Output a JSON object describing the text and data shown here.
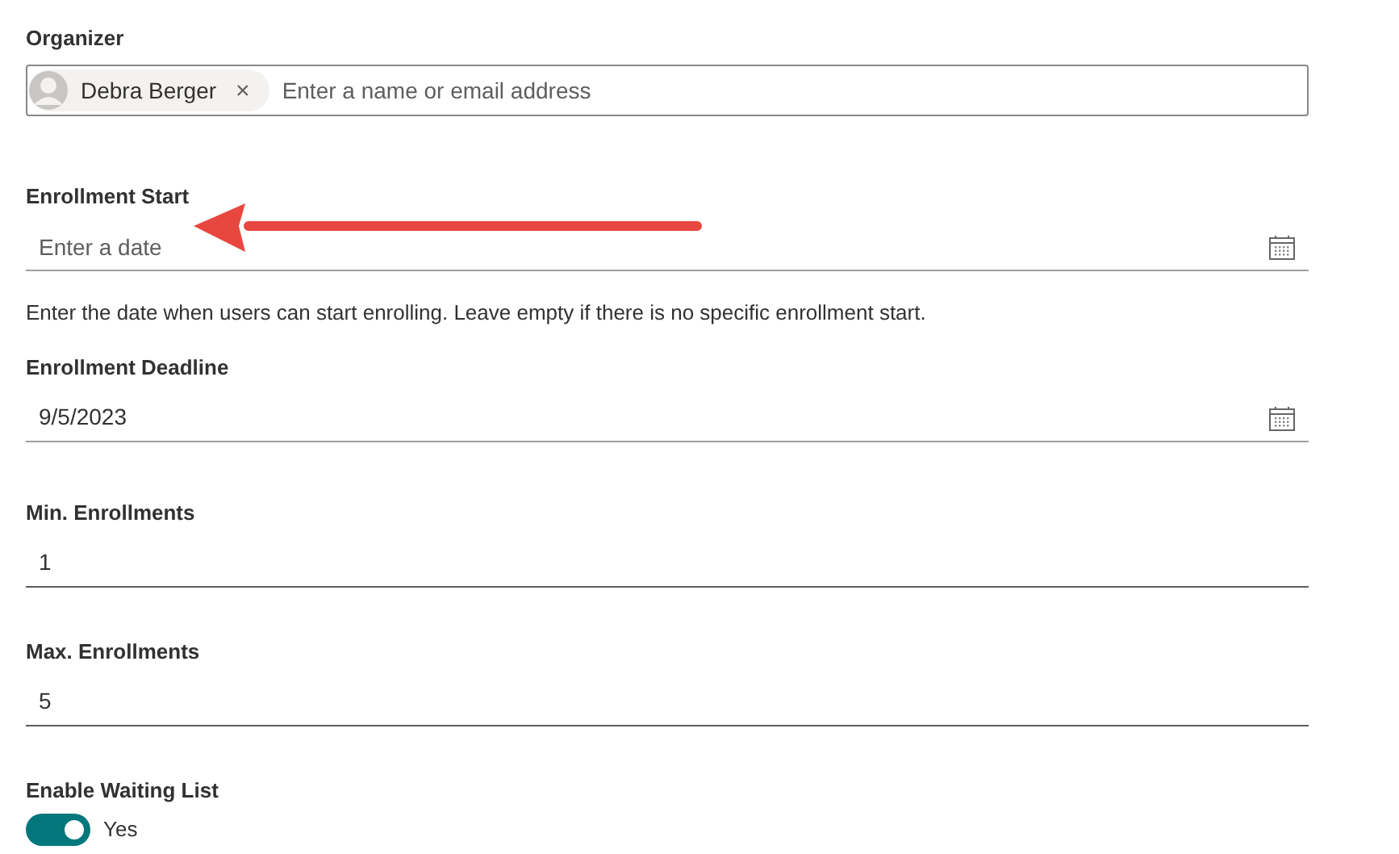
{
  "fields": [
    {
      "kind": "people",
      "label": "Organizer",
      "chips": [
        {
          "name": "Debra Berger",
          "remove": "×"
        }
      ],
      "placeholder": "Enter a name or email address"
    },
    {
      "kind": "date",
      "label": "Enrollment Start",
      "placeholder": "Enter a date",
      "help": "Enter the date when users can start enrolling. Leave empty if there is no specific enrollment start."
    },
    {
      "kind": "date",
      "label": "Enrollment Deadline",
      "value": "9/5/2023"
    },
    {
      "kind": "number",
      "label": "Min. Enrollments",
      "value": "1"
    },
    {
      "kind": "number",
      "label": "Max. Enrollments",
      "value": "5"
    },
    {
      "kind": "toggle",
      "label": "Enable Waiting List",
      "on": true,
      "state_text": "Yes"
    }
  ]
}
